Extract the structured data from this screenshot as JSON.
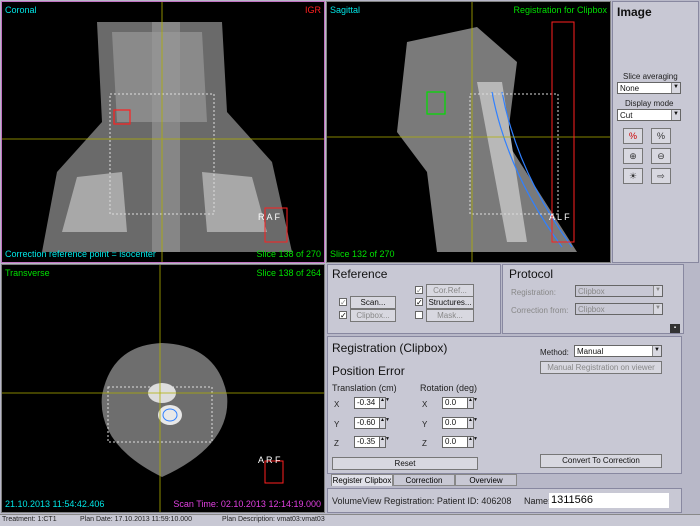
{
  "views": {
    "coronal": {
      "name": "Coronal",
      "tag": "IGR",
      "footer": "Correction reference point = isocenter",
      "slice": "Slice 138 of 270",
      "markers": "R A F"
    },
    "sagittal": {
      "name": "Sagittal",
      "tag": "Registration for Clipbox",
      "slice": "Slice 132 of 270",
      "markers": "A L F"
    },
    "transverse": {
      "name": "Transverse",
      "slice": "Slice 138 of 264",
      "datetime": "21.10.2013 11:54:42.406",
      "scan_time": "Scan Time: 02.10.2013 12:14:19.000",
      "markers": "A R F"
    }
  },
  "image_panel": {
    "title": "Image",
    "slice_avg_label": "Slice averaging",
    "slice_avg_value": "None",
    "display_mode_label": "Display mode",
    "display_mode_value": "Cut"
  },
  "reference": {
    "title": "Reference",
    "scan": "Scan...",
    "clipbox": "Clipbox...",
    "corref": "Cor.Ref...",
    "structures": "Structures...",
    "mask": "Mask..."
  },
  "protocol": {
    "title": "Protocol",
    "registration_label": "Registration:",
    "registration_value": "Clipbox",
    "correction_label": "Correction from:",
    "correction_value": "Clipbox"
  },
  "registration": {
    "title": "Registration (Clipbox)",
    "method_label": "Method:",
    "method_value": "Manual",
    "manual_btn": "Manual Registration on viewer",
    "position_error": "Position Error",
    "translation_label": "Translation (cm)",
    "rotation_label": "Rotation (deg)",
    "axes": [
      "X",
      "Y",
      "Z"
    ],
    "translation": [
      "-0.34",
      "-0.60",
      "-0.35"
    ],
    "rotation": [
      "0.0",
      "0.0",
      "0.0"
    ],
    "reset": "Reset",
    "convert": "Convert To Correction"
  },
  "tabs": [
    "Register Clipbox",
    "Correction",
    "Overview"
  ],
  "volumeview": {
    "label": "VolumeView Registration: Patient ID: 406208",
    "name_label": "Name:",
    "name_value": "1311566"
  },
  "statusbar": {
    "treatment": "Treatment: 1:CT1",
    "plan_date": "Plan Date: 17.10.2013 11:59:10.000",
    "plan_desc": "Plan Description: vmat03:vmat03"
  },
  "colors": {
    "panel": "#c8c8d4",
    "viewer_bg": "#000000",
    "cyan_text": "#00e5e5",
    "green_text": "#00e000",
    "red_text": "#ff2020",
    "magenta_text": "#e040e0"
  }
}
